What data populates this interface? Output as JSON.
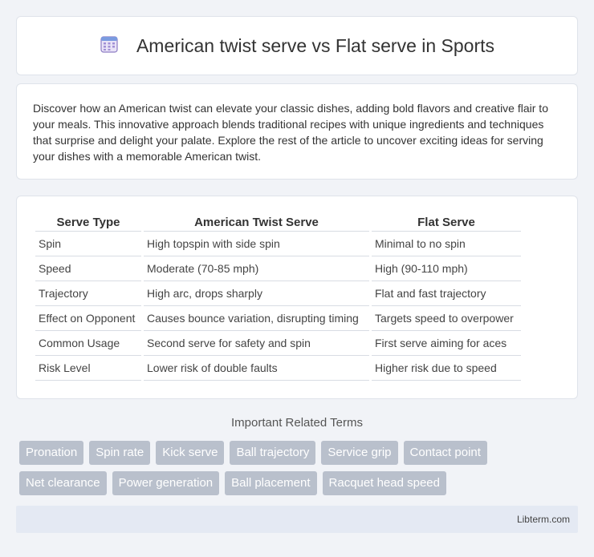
{
  "header": {
    "title": "American twist serve vs Flat serve in Sports",
    "icon": "calendar-grid-icon"
  },
  "intro": "Discover how an American twist can elevate your classic dishes, adding bold flavors and creative flair to your meals. This innovative approach blends traditional recipes with unique ingredients and techniques that surprise and delight your palate. Explore the rest of the article to uncover exciting ideas for serving your dishes with a memorable American twist.",
  "table": {
    "headers": [
      "Serve Type",
      "American Twist Serve",
      "Flat Serve"
    ],
    "rows": [
      [
        "Spin",
        "High topspin with side spin",
        "Minimal to no spin"
      ],
      [
        "Speed",
        "Moderate (70-85 mph)",
        "High (90-110 mph)"
      ],
      [
        "Trajectory",
        "High arc, drops sharply",
        "Flat and fast trajectory"
      ],
      [
        "Effect on Opponent",
        "Causes bounce variation, disrupting timing",
        "Targets speed to overpower"
      ],
      [
        "Common Usage",
        "Second serve for safety and spin",
        "First serve aiming for aces"
      ],
      [
        "Risk Level",
        "Lower risk of double faults",
        "Higher risk due to speed"
      ]
    ]
  },
  "related": {
    "title": "Important Related Terms",
    "row1": [
      "Pronation",
      "Spin rate",
      "Kick serve",
      "Ball trajectory",
      "Service grip",
      "Contact point"
    ],
    "row2": [
      "Net clearance",
      "Power generation",
      "Ball placement",
      "Racquet head speed"
    ]
  },
  "footer": "Libterm.com"
}
